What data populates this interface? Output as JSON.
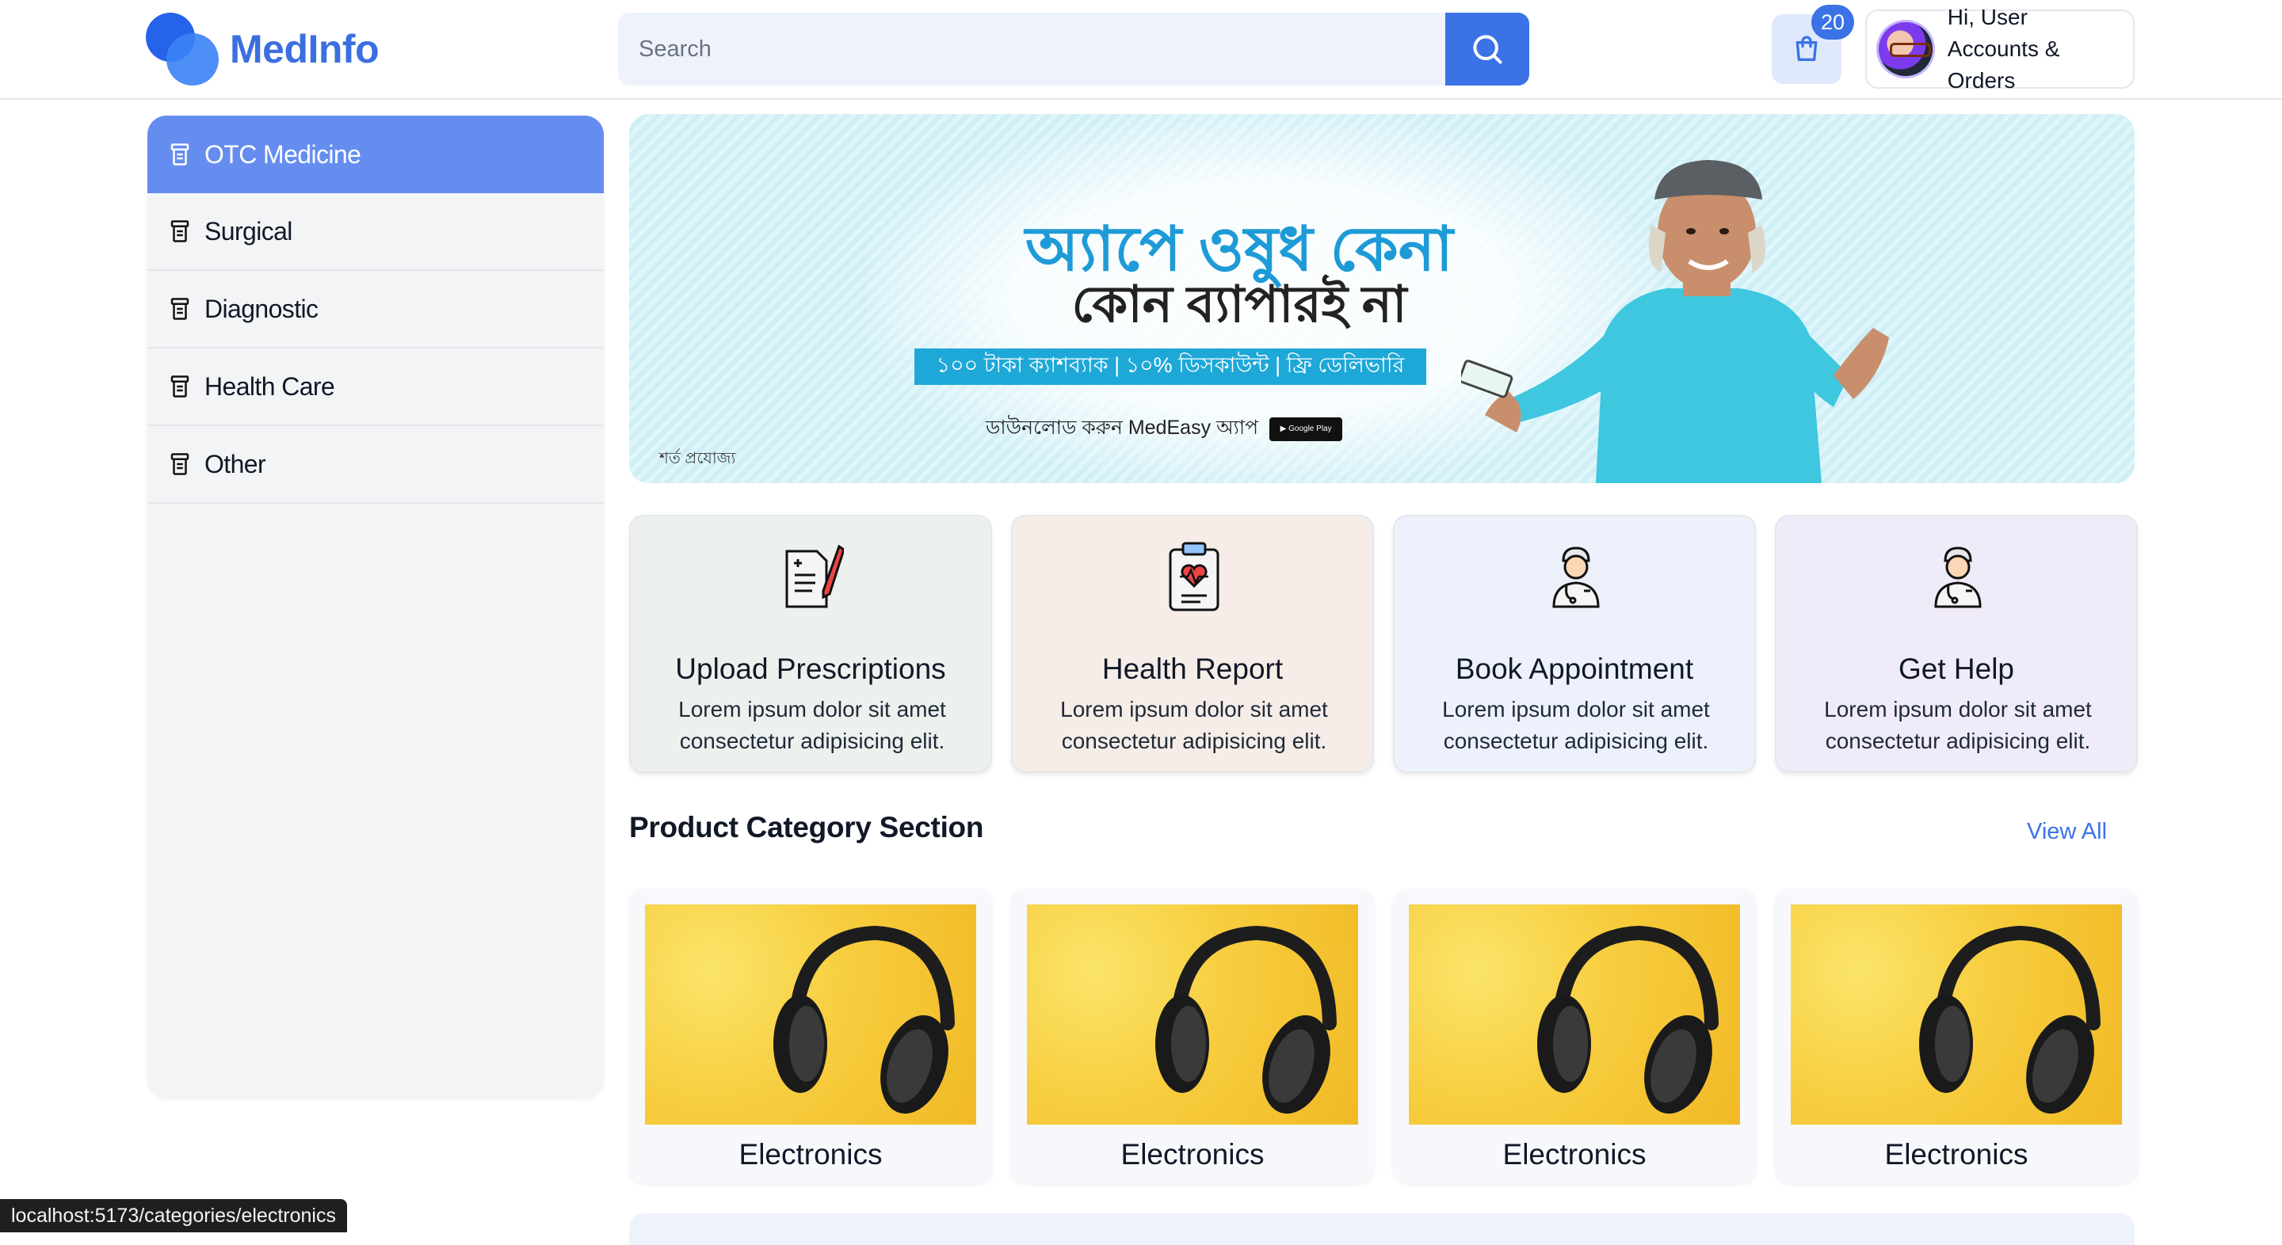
{
  "header": {
    "brand": "MedInfo",
    "search_placeholder": "Search",
    "cart_count": "20",
    "greeting": "Hi, User",
    "account_link": "Accounts & Orders"
  },
  "sidebar": {
    "items": [
      {
        "label": "OTC Medicine",
        "active": true
      },
      {
        "label": "Surgical",
        "active": false
      },
      {
        "label": "Diagnostic",
        "active": false
      },
      {
        "label": "Health Care",
        "active": false
      },
      {
        "label": "Other",
        "active": false
      }
    ]
  },
  "banner": {
    "headline": "অ্যাপে ওষুধ কেনা",
    "subheadline": "কোন ব্যাপারই না",
    "offer": "১০০ টাকা ক্যাশব্যাক | ১০% ডিসকাউন্ট | ফ্রি ডেলিভারি",
    "download": "ডাউনলোড করুন MedEasy অ্যাপ",
    "terms": "শর্ত প্রযোজ্য"
  },
  "services": [
    {
      "title": "Upload Prescriptions",
      "desc": "Lorem ipsum dolor sit amet consectetur adipisicing elit.",
      "icon": "prescription-icon",
      "bg": "#edf1ee"
    },
    {
      "title": "Health Report",
      "desc": "Lorem ipsum dolor sit amet consectetur adipisicing elit.",
      "icon": "health-report-icon",
      "bg": "#f6ede8"
    },
    {
      "title": "Book Appointment",
      "desc": "Lorem ipsum dolor sit amet consectetur adipisicing elit.",
      "icon": "doctor-icon",
      "bg": "#edf1fb"
    },
    {
      "title": "Get Help",
      "desc": "Lorem ipsum dolor sit amet consectetur adipisicing elit.",
      "icon": "doctor-icon",
      "bg": "#f0ebf8"
    }
  ],
  "product_section": {
    "title": "Product Category Section",
    "view_all": "View All",
    "items": [
      {
        "name": "Electronics",
        "image": "headphones-image"
      },
      {
        "name": "Electronics",
        "image": "headphones-image"
      },
      {
        "name": "Electronics",
        "image": "headphones-image"
      },
      {
        "name": "Electronics",
        "image": "headphones-image"
      }
    ]
  },
  "status_bar": {
    "url": "localhost:5173/categories/electronics"
  },
  "colors": {
    "brand": "#3b6fe0",
    "accent": "#3b73e6",
    "sidebar_active": "#658df0"
  }
}
